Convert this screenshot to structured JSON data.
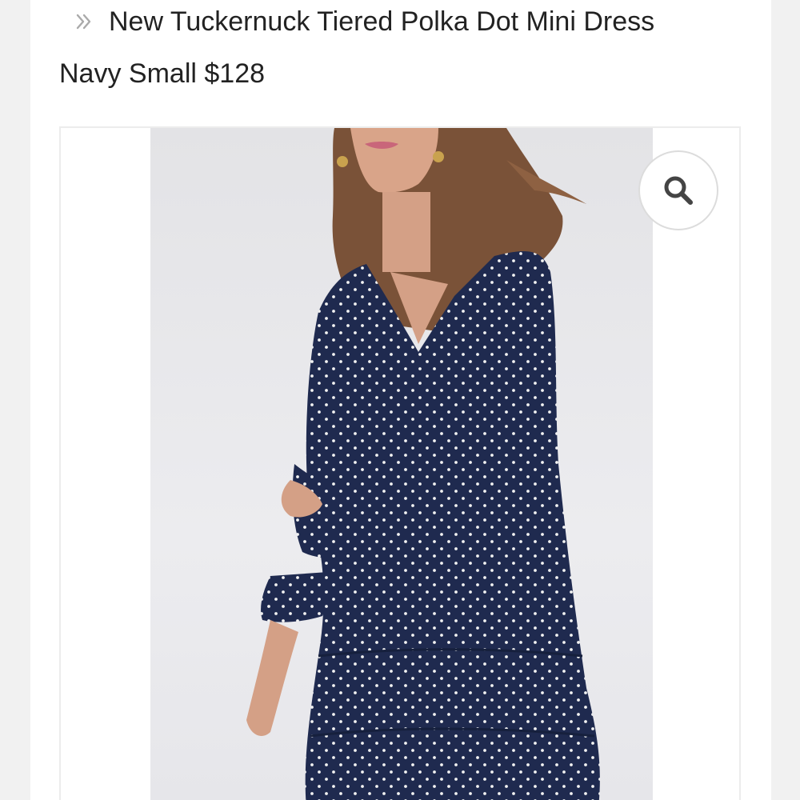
{
  "product": {
    "title": "New Tuckernuck Tiered Polka Dot Mini Dress",
    "subtitle": "Navy Small $128"
  },
  "icons": {
    "breadcrumb": "double-chevron-right-icon",
    "zoom": "search-icon"
  },
  "colors": {
    "dress": "#1f2a4f",
    "dots": "#f2f2f2",
    "background": "#ffffff",
    "text": "#222222"
  }
}
